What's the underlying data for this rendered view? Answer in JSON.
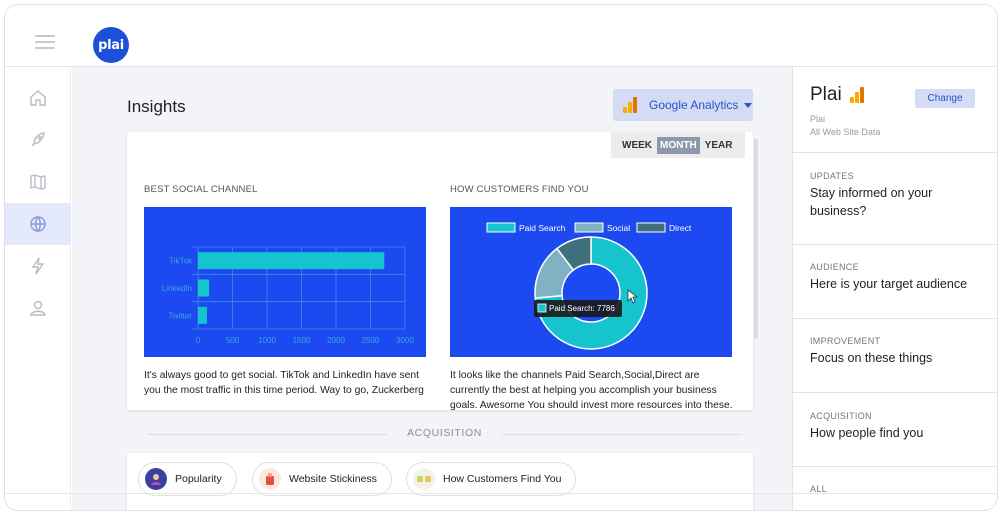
{
  "app": {
    "logo_text": "plai"
  },
  "rail": {
    "items": [
      "home-icon",
      "rocket-icon",
      "map-icon",
      "globe-icon",
      "bolt-icon",
      "user-icon"
    ],
    "active": "globe-icon"
  },
  "main": {
    "title": "Insights",
    "source_dropdown": "Google Analytics",
    "period": {
      "options": [
        "WEEK",
        "MONTH",
        "YEAR"
      ],
      "selected": "MONTH"
    },
    "best_social": {
      "label": "BEST SOCIAL CHANNEL",
      "description": "It's always good to get social. TikTok and LinkedIn have sent you the most traffic in this time period. Way to go, Zuckerberg"
    },
    "customers_find": {
      "label": "HOW CUSTOMERS FIND YOU",
      "description": "It looks like the channels Paid Search,Social,Direct are currently the best at helping you accomplish your business goals. Awesome You should invest more resources into these.",
      "tooltip": "Paid Search: 7786"
    },
    "section_divider": "ACQUISITION",
    "pills": [
      {
        "label": "Popularity",
        "icon": "popularity-icon"
      },
      {
        "label": "Website Stickiness",
        "icon": "stickiness-icon"
      },
      {
        "label": "How Customers Find You",
        "icon": "customers-find-icon"
      }
    ]
  },
  "chart_data": [
    {
      "type": "bar",
      "orientation": "horizontal",
      "categories": [
        "TikTok",
        "LinkedIn",
        "Twitter"
      ],
      "values": [
        2700,
        160,
        130
      ],
      "xlim": [
        0,
        3000
      ],
      "xticks": [
        "0",
        "500",
        "1000",
        "1500",
        "2000",
        "2500",
        "3000"
      ],
      "grid": true
    },
    {
      "type": "pie",
      "style": "doughnut",
      "series": [
        {
          "name": "Paid Search",
          "value": 7786,
          "color": "#16c4d0"
        },
        {
          "name": "Social",
          "value": 1700,
          "color": "#7fb3c4"
        },
        {
          "name": "Direct",
          "value": 1100,
          "color": "#3f6f7a"
        }
      ],
      "legend": "top"
    }
  ],
  "right": {
    "title": "Plai",
    "sub1": "Plai",
    "sub2": "All Web Site Data",
    "change_label": "Change",
    "sections": [
      {
        "key": "UPDATES",
        "value": "Stay informed on your business?"
      },
      {
        "key": "AUDIENCE",
        "value": "Here is your target audience"
      },
      {
        "key": "IMPROVEMENT",
        "value": "Focus on these things"
      },
      {
        "key": "ACQUISITION",
        "value": "How people find you"
      },
      {
        "key": "ALL",
        "value": ""
      }
    ]
  },
  "colors": {
    "accent": "#1c50d9",
    "panel_blue": "#1d4af0",
    "bar": "#16c4d0"
  }
}
